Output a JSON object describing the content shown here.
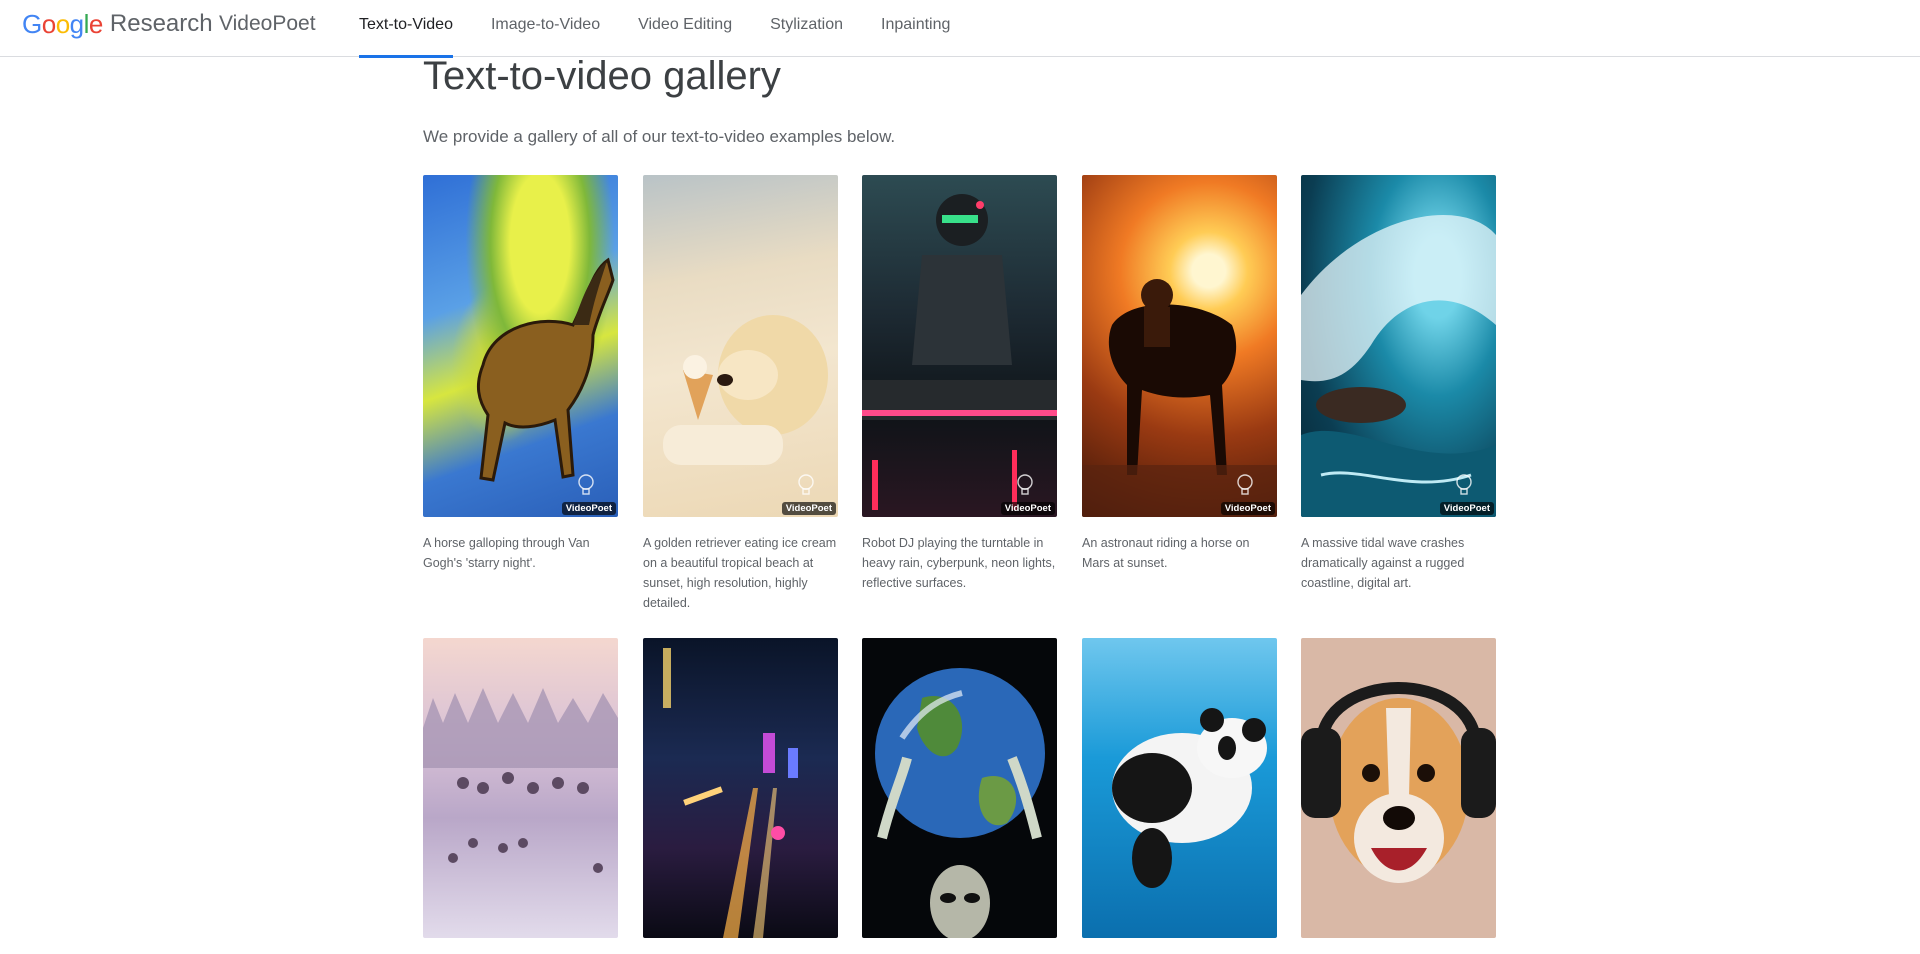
{
  "header": {
    "logo_google": "Google",
    "logo_research": "Research",
    "product": "VideoPoet",
    "tabs": [
      {
        "label": "Text-to-Video",
        "active": true
      },
      {
        "label": "Image-to-Video",
        "active": false
      },
      {
        "label": "Video Editing",
        "active": false
      },
      {
        "label": "Stylization",
        "active": false
      },
      {
        "label": "Inpainting",
        "active": false
      }
    ]
  },
  "main": {
    "title": "Text-to-video gallery",
    "intro": "We provide a gallery of all of our text-to-video examples below."
  },
  "gallery": [
    {
      "caption": "A horse galloping through Van Gogh's 'starry night'.",
      "badge": "VideoPoet"
    },
    {
      "caption": "A golden retriever eating ice cream on a beautiful tropical beach at sunset, high resolution, highly detailed.",
      "badge": "VideoPoet"
    },
    {
      "caption": "Robot DJ playing the turntable in heavy rain, cyberpunk, neon lights, reflective surfaces.",
      "badge": "VideoPoet"
    },
    {
      "caption": "An astronaut riding a horse on Mars at sunset.",
      "badge": "VideoPoet"
    },
    {
      "caption": "A massive tidal wave crashes dramatically against a rugged coastline, digital art.",
      "badge": "VideoPoet"
    },
    {
      "caption": "",
      "badge": ""
    },
    {
      "caption": "",
      "badge": ""
    },
    {
      "caption": "",
      "badge": ""
    },
    {
      "caption": "",
      "badge": ""
    },
    {
      "caption": "",
      "badge": ""
    }
  ],
  "colors": {
    "accent": "#1a73e8",
    "divider": "#dadce0",
    "text_muted": "#5f6368"
  }
}
